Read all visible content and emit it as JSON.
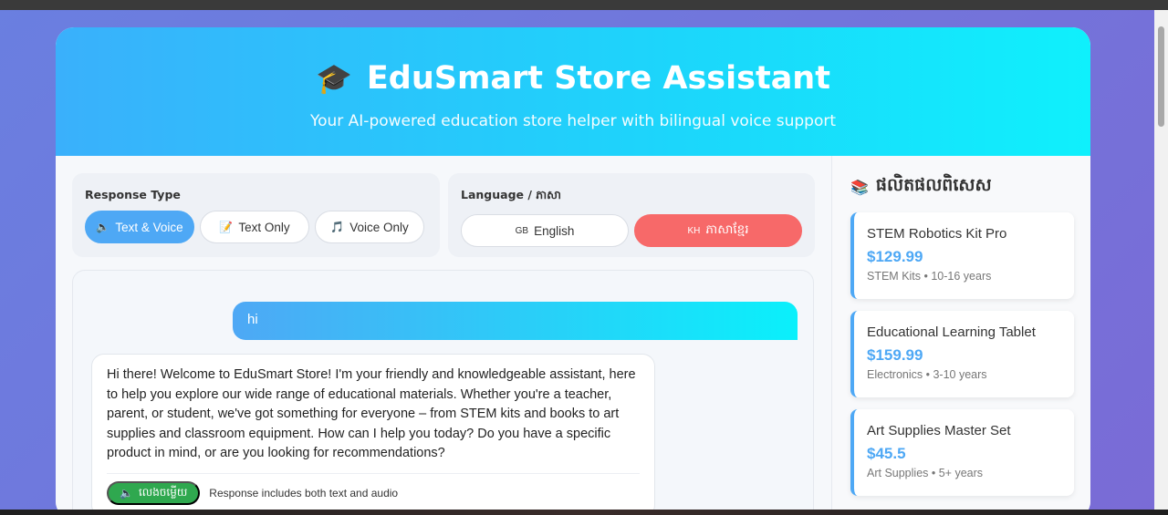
{
  "header": {
    "icon": "graduation-cap-icon",
    "title": "EduSmart Store Assistant",
    "subtitle": "Your AI-powered education store helper with bilingual voice support"
  },
  "response_type": {
    "title": "Response Type",
    "options": [
      {
        "icon": "speaker-icon",
        "label": "Text & Voice",
        "active": true
      },
      {
        "icon": "memo-icon",
        "label": "Text Only",
        "active": false
      },
      {
        "icon": "music-note-icon",
        "label": "Voice Only",
        "active": false
      }
    ]
  },
  "language": {
    "title": "Language / ភាសា",
    "options": [
      {
        "flag": "GB",
        "label": "English",
        "active": false
      },
      {
        "flag": "KH",
        "label": "ភាសាខ្មែរ",
        "active": true
      }
    ]
  },
  "chat": {
    "user_message": "hi",
    "bot_message": "Hi there! Welcome to EduSmart Store! I'm your friendly and knowledgeable assistant, here to help you explore our wide range of educational materials. Whether you're a teacher, parent, or student, we've got something for everyone – from STEM kits and books to art supplies and classroom equipment. How can I help you today? Do you have a specific product in mind, or are you looking for recommendations?",
    "play_label": "លេងចម្លើយ",
    "play_note": "Response includes both text and audio"
  },
  "sidebar": {
    "icon": "books-icon",
    "title": "ផលិតផលពិសេស",
    "products": [
      {
        "name": "STEM Robotics Kit Pro",
        "price": "$129.99",
        "meta": "STEM Kits • 10-16 years"
      },
      {
        "name": "Educational Learning Tablet",
        "price": "$159.99",
        "meta": "Electronics • 3-10 years"
      },
      {
        "name": "Art Supplies Master Set",
        "price": "$45.5",
        "meta": "Art Supplies • 5+ years"
      }
    ]
  },
  "colors": {
    "accent": "#4ea8f5",
    "header_gradient_end": "#0ff0fc",
    "active_language": "#f76969",
    "play_button": "#2fa84f"
  }
}
